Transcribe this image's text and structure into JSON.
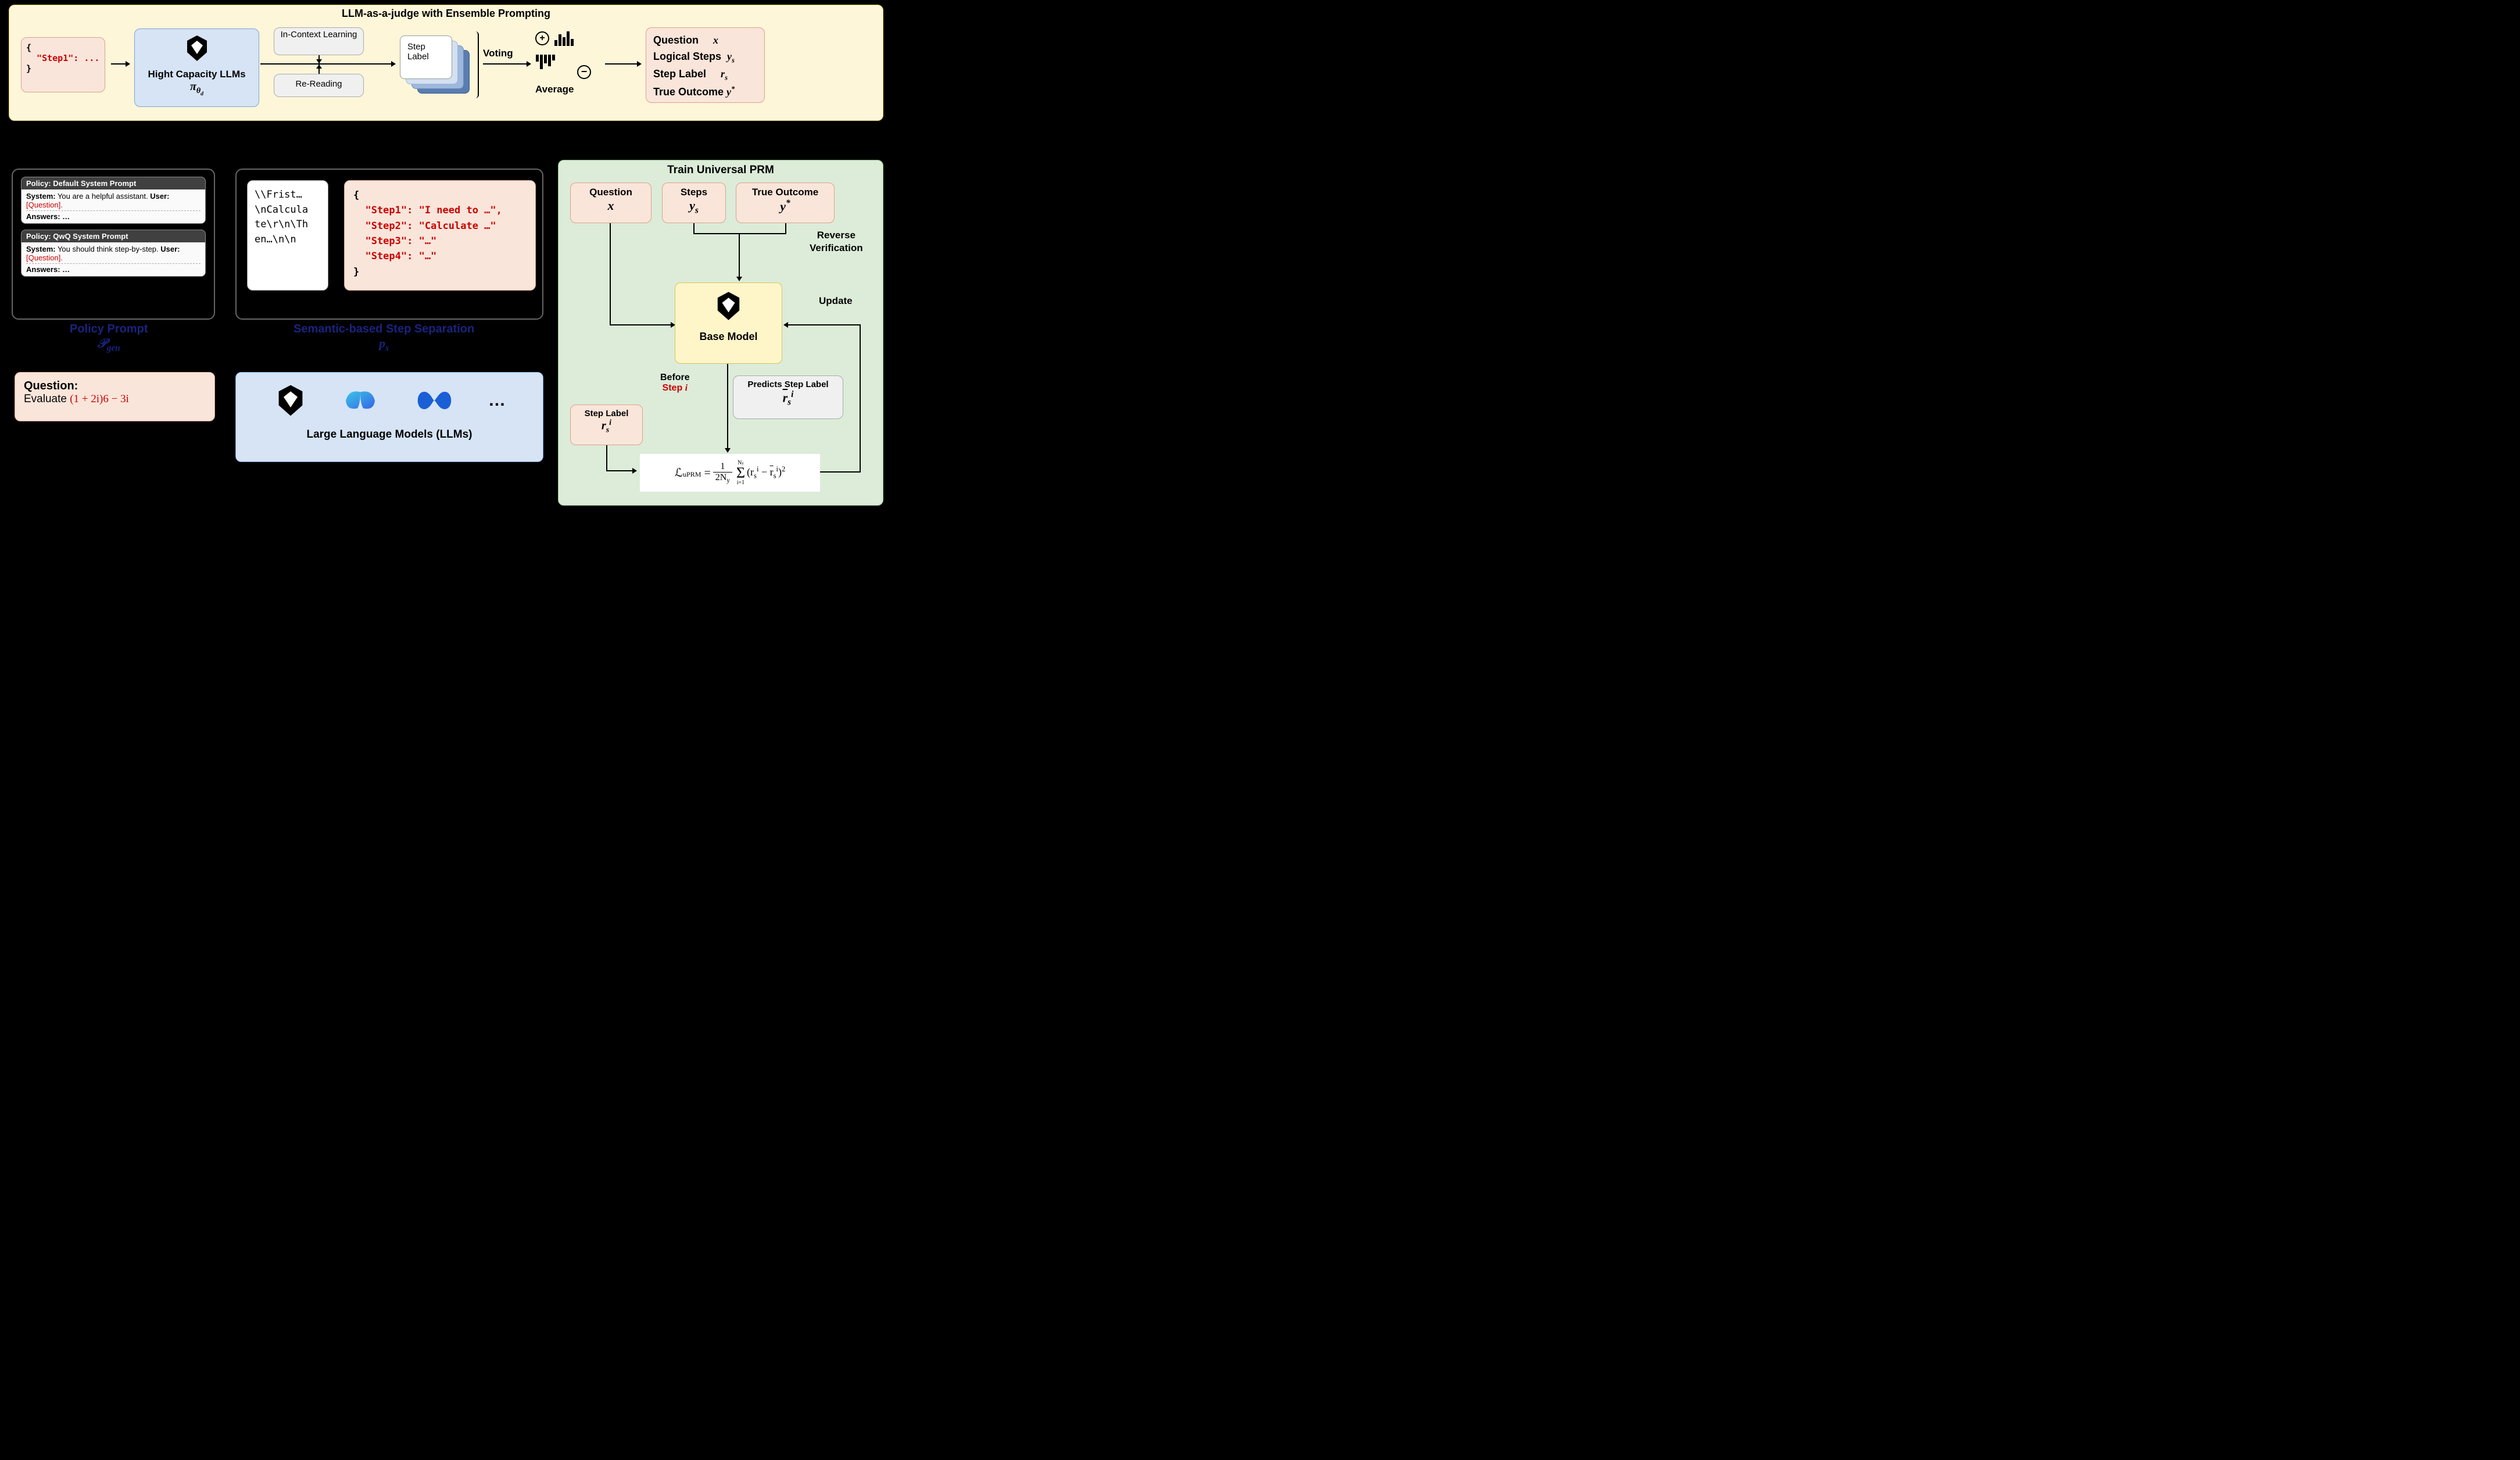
{
  "panelA": {
    "title": "LLM-as-a-judge with Ensemble Prompting",
    "step1_json_open": "{",
    "step1_json_key": "  \"Step1\": ...",
    "step1_json_close": "}",
    "llm_caption": "Hight Capacity LLMs",
    "llm_symbol": "π",
    "llm_symbol_sub": "θ_d",
    "icl_label": "In-Context Learning",
    "reread_label": "Re-Reading",
    "steplabel_label_line1": "Step",
    "steplabel_label_line2": "Label",
    "voting_label": "Voting",
    "average_label": "Average",
    "plus_label": "+",
    "minus_label": "−",
    "output_question": "Question",
    "output_question_sym": "x",
    "output_steps": "Logical Steps",
    "output_steps_sym": "y_s",
    "output_label": "Step Label",
    "output_label_sym": "r_s",
    "output_outcome": "True Outcome",
    "output_outcome_sym": "y*"
  },
  "panelB": {
    "policy1_title": "Policy: Default System Prompt",
    "policy1_system_label": "System:",
    "policy1_system_text": " You are a helpful assistant. ",
    "policy1_user_label": "User:",
    "policy1_user_text": " [Question].",
    "policy1_answers": "Answers: …",
    "policy2_title": "Policy: QwQ System Prompt",
    "policy2_system_label": "System:",
    "policy2_system_text": " You should think step-by-step. ",
    "policy2_user_label": "User:",
    "policy2_user_text": " [Question].",
    "policy2_answers": "Answers: …",
    "policy_label": "Policy Prompt",
    "policy_symbol": "𝒫_gen",
    "question_label": "Question:",
    "question_text_pre": "Evaluate ",
    "question_math": "(1 + 2i)6 − 3i"
  },
  "panelC": {
    "rawtext": "\\\\Frist…\\nCalculate\\r\\n\\Then…\\n\\n",
    "json_open": "{",
    "json_line1": "  \"Step1\": \"I need to …\",",
    "json_line2": "  \"Step2\": \"Calculate …\"",
    "json_line3": "  \"Step3\": \"…\"",
    "json_line4": "  \"Step4\": \"…\"",
    "json_close": "}",
    "semantic_label": "Semantic-based Step Separation",
    "semantic_symbol": "p_s",
    "llms_caption": "Large Language Models (LLMs)",
    "ellipsis": "…"
  },
  "panelD": {
    "title": "Train Universal PRM",
    "question_label": "Question",
    "question_sym": "x",
    "steps_label": "Steps",
    "steps_sym": "y_s",
    "outcome_label": "True Outcome",
    "outcome_sym": "y*",
    "reverse_verification": "Reverse Verification",
    "base_model": "Base Model",
    "update": "Update",
    "before": "Before",
    "step_i": "Step i",
    "predicts_label": "Predicts Step Label",
    "predicts_sym": "r̄_s^i",
    "steplabel_label": "Step Label",
    "steplabel_sym": "r_s^i",
    "loss_symbol": "ℒ_uPRM",
    "loss_formula_a": " = ",
    "loss_formula_frac_num": "1",
    "loss_formula_frac_den": "2N_y",
    "loss_formula_sum": "Σ",
    "loss_formula_sum_lo": "i=1",
    "loss_formula_sum_hi": "N_y",
    "loss_formula_body": "(r_s^i − r̄_s^i)²"
  }
}
